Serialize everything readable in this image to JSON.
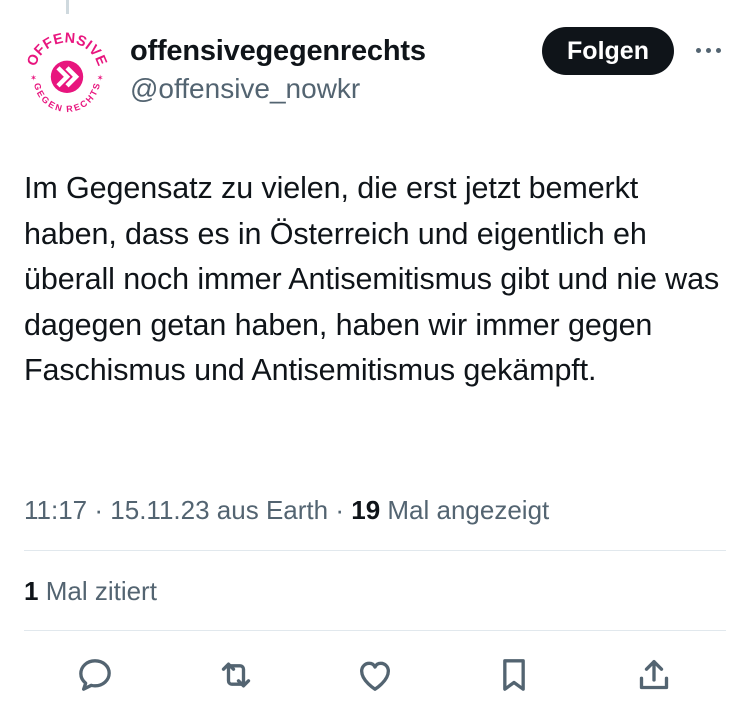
{
  "tweet": {
    "author": {
      "display_name": "offensivegegenrechts",
      "handle": "@offensive_nowkr",
      "avatar_top_text": "OFFENSIVE",
      "avatar_bottom_text": "GEGEN RECHTS",
      "avatar_color": "#e8157e"
    },
    "follow_label": "Folgen",
    "text": "Im Gegensatz zu vielen, die erst jetzt bemerkt haben, dass es in Österreich und eigentlich eh überall noch immer Antisemitismus gibt und nie was dagegen getan haben, haben wir immer gegen Faschismus und Antisemitismus gekämpft.",
    "time": "11:17",
    "date": "15.11.23",
    "source": "aus Earth",
    "separator": "·",
    "views_count": "19",
    "views_label": "Mal angezeigt",
    "quotes_count": "1",
    "quotes_label": "Mal zitiert"
  },
  "icons": {
    "reply": "reply-icon",
    "retweet": "retweet-icon",
    "like": "like-icon",
    "bookmark": "bookmark-icon",
    "share": "share-icon",
    "more": "more-icon"
  },
  "colors": {
    "primary_text": "#0f1419",
    "secondary_text": "#536471",
    "follow_bg": "#0f1419",
    "divider": "#e1e8ed"
  }
}
